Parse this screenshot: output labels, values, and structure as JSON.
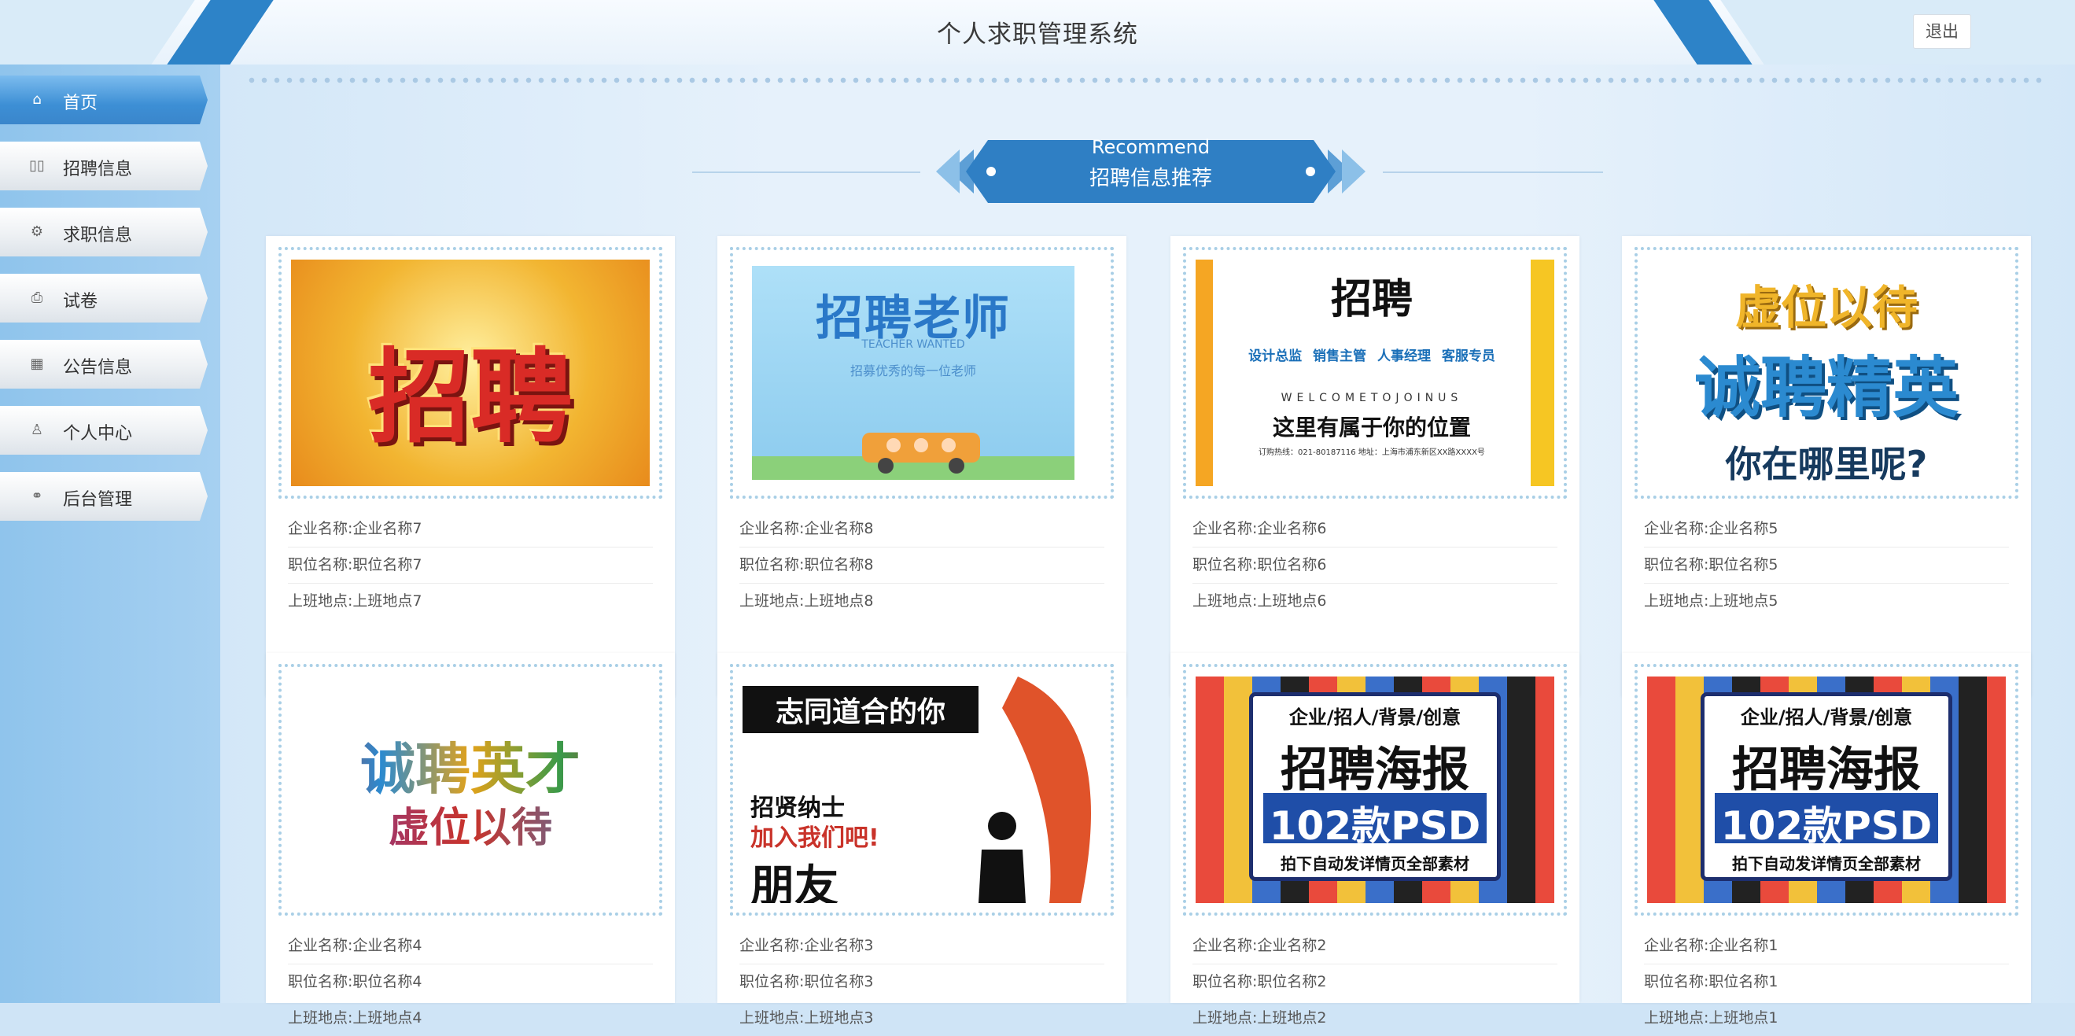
{
  "header": {
    "title": "个人求职管理系统",
    "logout_label": "退出"
  },
  "sidebar": {
    "items": [
      {
        "label": "首页",
        "icon": "home-icon",
        "glyph": "⌂",
        "active": true
      },
      {
        "label": "招聘信息",
        "icon": "columns-icon",
        "glyph": "▯▯"
      },
      {
        "label": "求职信息",
        "icon": "gear-icon",
        "glyph": "⚙"
      },
      {
        "label": "试卷",
        "icon": "printer-icon",
        "glyph": "⎙"
      },
      {
        "label": "公告信息",
        "icon": "grid-icon",
        "glyph": "▦"
      },
      {
        "label": "个人中心",
        "icon": "user-icon",
        "glyph": "♙"
      },
      {
        "label": "后台管理",
        "icon": "link-icon",
        "glyph": "⚭"
      }
    ]
  },
  "section": {
    "title_en": "Recommend",
    "title_zh": "招聘信息推荐"
  },
  "labels": {
    "company": "企业名称:",
    "position": "职位名称:",
    "location": "上班地点:"
  },
  "cards": [
    {
      "company": "企业名称7",
      "position": "职位名称7",
      "location": "上班地点7",
      "poster": {
        "lines": [
          "招聘"
        ],
        "bg": "#f2b531",
        "color": "#d92b26"
      }
    },
    {
      "company": "企业名称8",
      "position": "职位名称8",
      "location": "上班地点8",
      "poster": {
        "lines": [
          "招聘老师",
          "TEACHER WANTED",
          "招募优秀的每一位老师"
        ],
        "bg": "#9ed5f2",
        "color": "#2a78c8"
      }
    },
    {
      "company": "企业名称6",
      "position": "职位名称6",
      "location": "上班地点6",
      "poster": {
        "lines": [
          "招聘",
          "设计总监  销售主管  人事经理  客服专员",
          "WELCOMETOJOINUS",
          "这里有属于你的位置",
          "订购热线：021-80187116  地址：上海市浦东新区XX路XXXX号"
        ],
        "bg": "#ffffff",
        "color": "#222222"
      }
    },
    {
      "company": "企业名称5",
      "position": "职位名称5",
      "location": "上班地点5",
      "poster": {
        "lines": [
          "虚位以待",
          "诚聘精英",
          "你在哪里呢?"
        ],
        "bg": "#ffffff",
        "color": "#1e73b8"
      }
    },
    {
      "company": "企业名称4",
      "position": "职位名称4",
      "location": "上班地点4",
      "poster": {
        "lines": [
          "诚聘英才",
          "虚位以待"
        ],
        "bg": "#ffffff",
        "color": "#c9332a"
      }
    },
    {
      "company": "企业名称3",
      "position": "职位名称3",
      "location": "上班地点3",
      "poster": {
        "lines": [
          "志同道合的你",
          "招贤纳士",
          "加入我们吧!",
          "朋友"
        ],
        "bg": "#ffffff",
        "color": "#111111"
      }
    },
    {
      "company": "企业名称2",
      "position": "职位名称2",
      "location": "上班地点2",
      "poster": {
        "lines": [
          "企业/招人/背景/创意",
          "招聘海报",
          "102款PSD",
          "拍下自动发详情页全部素材"
        ],
        "bg": "#e94a3c",
        "color": "#111111"
      }
    },
    {
      "company": "企业名称1",
      "position": "职位名称1",
      "location": "上班地点1",
      "poster": {
        "lines": [
          "企业/招人/背景/创意",
          "招聘海报",
          "102款PSD",
          "拍下自动发详情页全部素材"
        ],
        "bg": "#e94a3c",
        "color": "#111111"
      }
    }
  ]
}
